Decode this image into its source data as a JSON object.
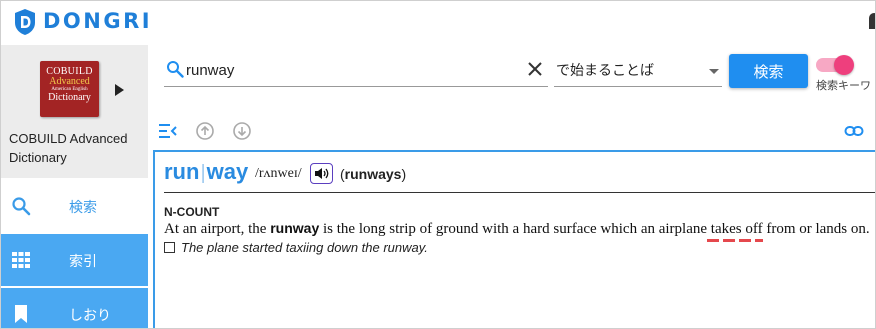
{
  "app": {
    "name": "DONGRI",
    "brand_color": "#1f7fd8"
  },
  "sidebar": {
    "dictionary": {
      "cover": {
        "line1": "COBUILD",
        "line2": "Advanced",
        "line3": "American English",
        "line4": "Dictionary"
      },
      "name": "COBUILD Advanced Dictionary"
    },
    "nav": [
      {
        "label": "検索",
        "icon": "search-icon",
        "active": true
      },
      {
        "label": "索引",
        "icon": "grid-icon"
      },
      {
        "label": "しおり",
        "icon": "bookmark-icon"
      }
    ],
    "accent": "#4aa8f2"
  },
  "search": {
    "query": "runway",
    "mode": "で始まることば",
    "button_label": "検索",
    "toggle_label": "検索キーワ",
    "toggle_on": true
  },
  "toolbar": {
    "icons": [
      "collapse-list-icon",
      "up-arrow-icon",
      "down-arrow-icon",
      "link-icon"
    ]
  },
  "entry": {
    "headword_part1": "run",
    "headword_part2": "way",
    "pronunciation": "/rʌnweɪ/",
    "plural": "runways",
    "pos": "N-COUNT",
    "definition_before": "At an airport, the ",
    "definition_keyword": "runway",
    "definition_after": " is the long strip of ground with a hard surface which an airplane takes off from or lands on.",
    "example": "The plane started taxiing down the runway."
  }
}
